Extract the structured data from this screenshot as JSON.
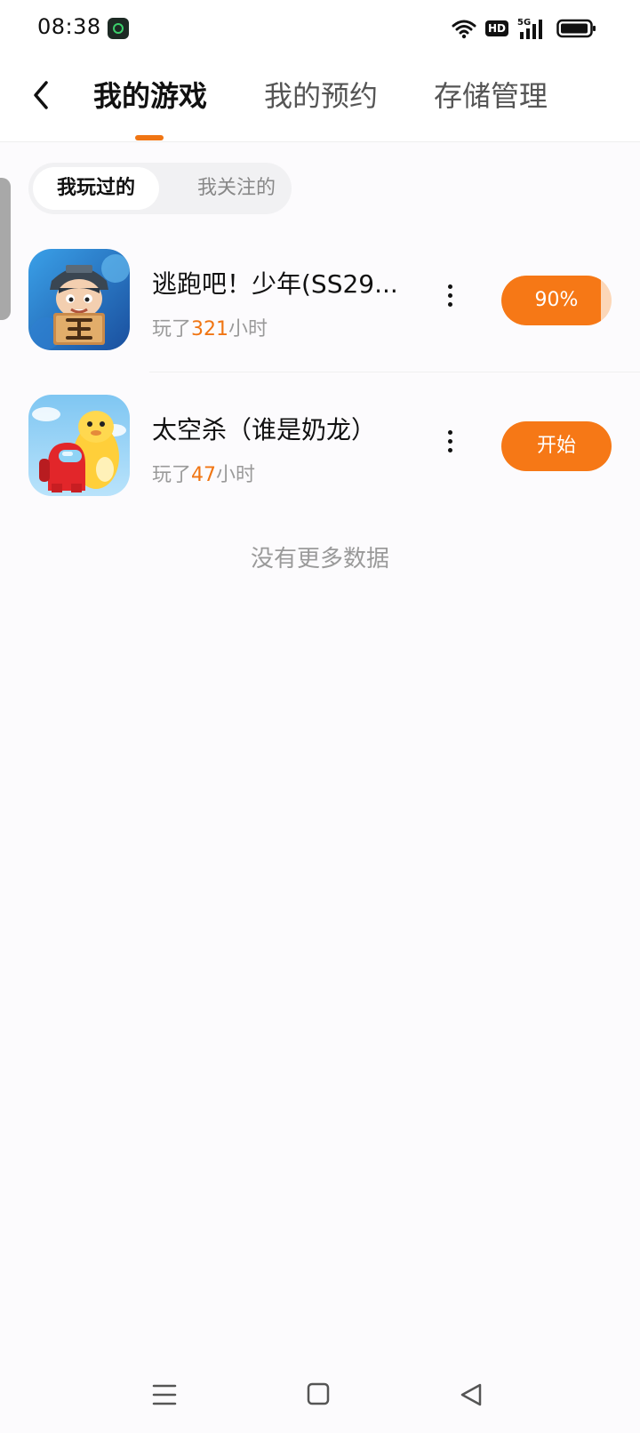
{
  "status_bar": {
    "time": "08:38",
    "network_badge": "HD",
    "network_type": "5G",
    "icons": [
      "app-icon",
      "wifi-icon",
      "hd-icon",
      "signal-icon",
      "battery-icon"
    ]
  },
  "header": {
    "back_icon": "chevron-left-icon",
    "tabs": [
      {
        "label": "我的游戏",
        "active": true
      },
      {
        "label": "我的预约",
        "active": false
      },
      {
        "label": "存储管理",
        "active": false
      }
    ]
  },
  "filter": {
    "options": [
      {
        "label": "我玩过的",
        "selected": true
      },
      {
        "label": "我关注的",
        "selected": false
      }
    ]
  },
  "games": [
    {
      "name": "逃跑吧！少年(SS29...",
      "played_prefix": "玩了",
      "hours": "321",
      "played_suffix": "小时",
      "action_label": "90%",
      "progress": 0.9,
      "more_icon": "more-vertical-icon"
    },
    {
      "name": "太空杀（谁是奶龙）",
      "played_prefix": "玩了",
      "hours": "47",
      "played_suffix": "小时",
      "action_label": "开始",
      "more_icon": "more-vertical-icon"
    }
  ],
  "footer_message": "没有更多数据",
  "nav": {
    "icons": [
      "menu-icon",
      "home-square-icon",
      "back-triangle-icon"
    ]
  },
  "colors": {
    "accent": "#f67816",
    "background": "#fcfbfd",
    "muted_text": "#9a9a9a"
  }
}
